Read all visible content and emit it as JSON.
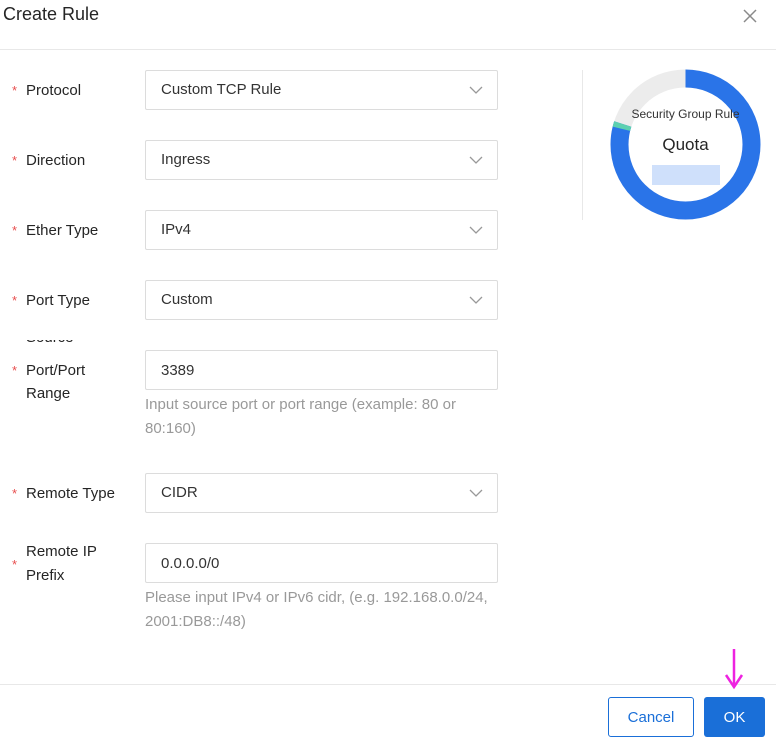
{
  "dialog": {
    "title": "Create Rule"
  },
  "form": {
    "protocol": {
      "label": "Protocol",
      "value": "Custom TCP Rule"
    },
    "direction": {
      "label": "Direction",
      "value": "Ingress"
    },
    "ether_type": {
      "label": "Ether Type",
      "value": "IPv4"
    },
    "port_type": {
      "label": "Port Type",
      "value": "Custom"
    },
    "source_port": {
      "label_line1": "Source",
      "label_line2": "Port/Port",
      "label_line3": "Range",
      "value": "3389",
      "hint_line1": "Input source port or port range (example: 80 or",
      "hint_line2": "80:160)"
    },
    "remote_type": {
      "label": "Remote Type",
      "value": "CIDR"
    },
    "remote_ip": {
      "label_line1": "Remote IP",
      "label_line2": "Prefix",
      "value": "0.0.0.0/0",
      "hint_line1": "Please input IPv4 or IPv6 cidr, (e.g. 192.168.0.0/24,",
      "hint_line2": "2001:DB8::/48)"
    },
    "required_mark": "*"
  },
  "quota": {
    "label": "Security Group Rule",
    "title": "Quota",
    "used_fraction": 0.8,
    "colors": {
      "used": "#2a74e8",
      "accent": "#5cd0b0",
      "track": "#ececec"
    }
  },
  "footer": {
    "cancel_label": "Cancel",
    "ok_label": "OK"
  },
  "colors": {
    "primary": "#1a6fd8",
    "required": "#e84e4e",
    "pointer": "#ee22e0"
  }
}
